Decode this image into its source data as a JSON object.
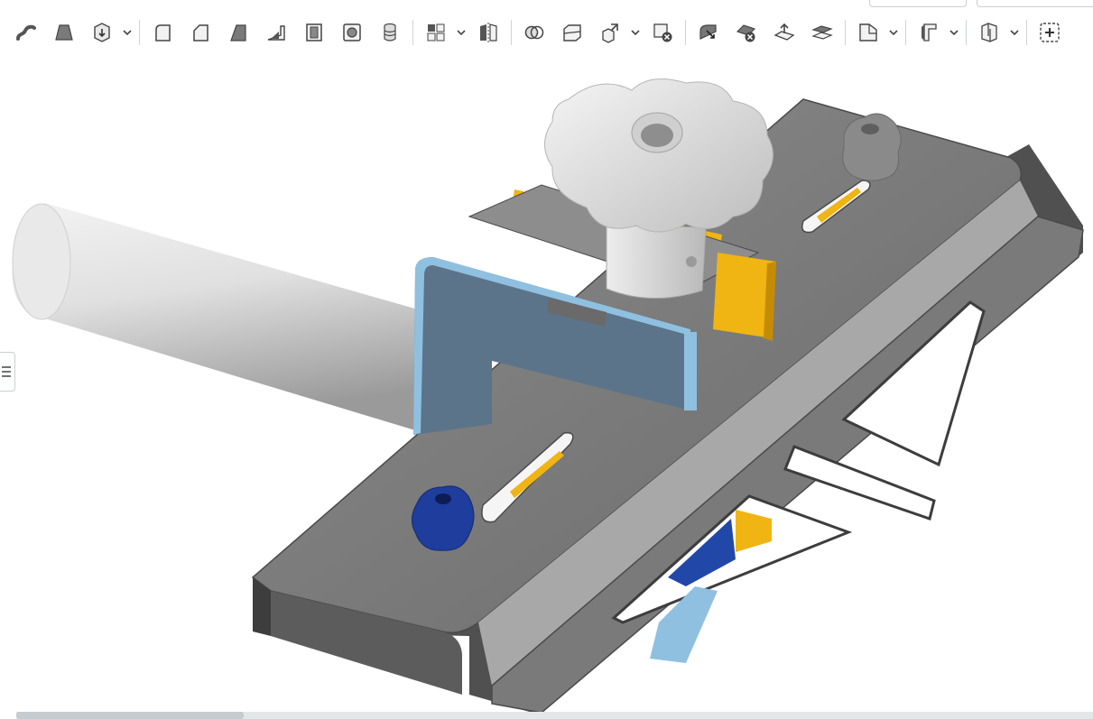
{
  "app": {
    "toolbar_items": [
      {
        "name": "sweep-icon",
        "has_dropdown": false
      },
      {
        "name": "loft-icon",
        "has_dropdown": false
      },
      {
        "name": "thicken-icon",
        "has_dropdown": true
      },
      {
        "name": "fillet-icon",
        "has_dropdown": false
      },
      {
        "name": "chamfer-icon",
        "has_dropdown": false
      },
      {
        "name": "draft-icon",
        "has_dropdown": false
      },
      {
        "name": "rib-icon",
        "has_dropdown": false
      },
      {
        "name": "shell-icon",
        "has_dropdown": false
      },
      {
        "name": "hole-icon",
        "has_dropdown": false
      },
      {
        "name": "thread-icon",
        "has_dropdown": false
      },
      {
        "name": "linear-pattern-icon",
        "has_dropdown": true
      },
      {
        "name": "mirror-icon",
        "has_dropdown": false
      },
      {
        "name": "boolean-icon",
        "has_dropdown": false
      },
      {
        "name": "split-icon",
        "has_dropdown": false
      },
      {
        "name": "transform-icon",
        "has_dropdown": true
      },
      {
        "name": "delete-part-icon",
        "has_dropdown": false
      },
      {
        "name": "modify-fillet-icon",
        "has_dropdown": false
      },
      {
        "name": "delete-face-icon",
        "has_dropdown": false
      },
      {
        "name": "move-face-icon",
        "has_dropdown": false
      },
      {
        "name": "replace-face-icon",
        "has_dropdown": false
      },
      {
        "name": "plane-icon",
        "has_dropdown": true
      },
      {
        "name": "sheet-metal-icon",
        "has_dropdown": true
      },
      {
        "name": "frame-icon",
        "has_dropdown": true
      },
      {
        "name": "add-custom-feature-icon",
        "has_dropdown": false
      }
    ],
    "side_panel_toggle": "list-icon"
  },
  "viewport": {
    "description_icon": "3d-model-viewport",
    "colors": {
      "metal": "#7d7d7d",
      "knob": "#e2e2e2",
      "bracket": "#5b7489",
      "bracket_edge": "#8fc0e0",
      "spacer": "#f0b413",
      "blue_knob": "#1f3d9c",
      "shaft": "#dcdcdc"
    }
  }
}
